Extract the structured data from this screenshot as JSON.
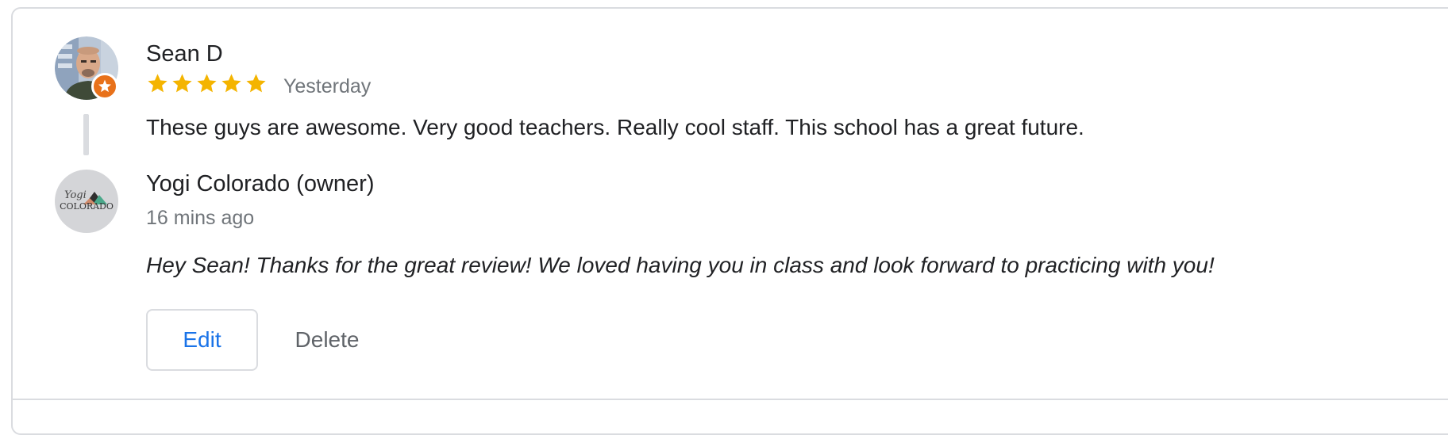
{
  "review": {
    "reviewer_name": "Sean D",
    "rating": 5,
    "rating_max": 5,
    "date": "Yesterday",
    "text": "These guys are awesome. Very good teachers. Really cool staff. This school has a great future."
  },
  "reply": {
    "owner_name": "Yogi Colorado (owner)",
    "date": "16 mins ago",
    "text": "Hey Sean! Thanks for the great review! We loved having you in class and look forward to practicing with you!",
    "logo_text_top": "Yogi",
    "logo_text_bottom": "COLORADO"
  },
  "actions": {
    "edit_label": "Edit",
    "delete_label": "Delete"
  },
  "colors": {
    "star": "#f4b400",
    "accent": "#1a73e8",
    "badge": "#e8711a",
    "secondary_text": "#70757a",
    "border": "#dadce0"
  },
  "icons": {
    "star": "star-icon",
    "badge": "local-guide-badge-icon"
  }
}
